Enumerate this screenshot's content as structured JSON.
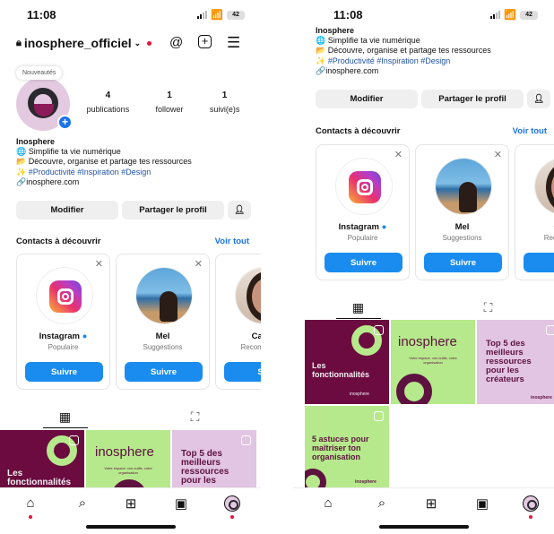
{
  "left": {
    "time": "11:08",
    "battery": "42",
    "username": "inosphere_officiel",
    "note": "Nouveautés",
    "stats": [
      {
        "num": "4",
        "label": "publications"
      },
      {
        "num": "1",
        "label": "follower"
      },
      {
        "num": "1",
        "label": "suivi(e)s"
      }
    ],
    "name": "Inosphere",
    "bio1": "🌐 Simplifie ta vie numérique",
    "bio2": "📂 Découvre, organise et partage tes ressources",
    "bio3": "✨ #Productivité #Inspiration #Design",
    "bio4": "🔗inosphere.com",
    "btn_edit": "Modifier",
    "btn_share": "Partager le profil",
    "sugg_title": "Contacts à découvrir",
    "sugg_all": "Voir tout",
    "cards": [
      {
        "name": "Instagram",
        "sub": "Populaire",
        "follow": "Suivre"
      },
      {
        "name": "Mel",
        "sub": "Suggestions",
        "follow": "Suivre"
      },
      {
        "name": "Cand",
        "sub": "Recom par In",
        "follow": "Su"
      }
    ],
    "tile1": "Les fonctionnalités",
    "tile2": "inosphere",
    "tile2sub": "Votre espace, vos outils, votre organisation",
    "tile3": "Top 5 des meilleurs ressources pour les"
  },
  "right": {
    "time": "11:08",
    "battery": "42",
    "name": "Inosphere",
    "bio1": "🌐 Simplifie ta vie numérique",
    "bio2": "📂 Découvre, organise et partage tes ressources",
    "bio3": "✨ #Productivité #Inspiration #Design",
    "bio4": "🔗inosphere.com",
    "btn_edit": "Modifier",
    "btn_share": "Partager le profil",
    "sugg_title": "Contacts à découvrir",
    "sugg_all": "Voir tout",
    "cards": [
      {
        "name": "Instagram",
        "sub": "Populaire",
        "follow": "Suivre"
      },
      {
        "name": "Mel",
        "sub": "Suggestions",
        "follow": "Suivre"
      },
      {
        "name": "Can",
        "sub": "Reco par Ir",
        "follow": "S"
      }
    ],
    "tile1a": "Les",
    "tile1b": "fonctionnalités",
    "tile1brand": "inosphere",
    "tile2": "inosphere",
    "tile2sub": "Votre espace, vos outils, votre organisation",
    "tile3": "Top 5 des meilleurs ressources pour les créateurs",
    "tile3brand": "inosphere",
    "tile4": "5 astuces pour maîtriser ton organisation",
    "tile4brand": "inosphere"
  },
  "colors": {
    "accent": "#1a8cf0",
    "plum": "#6b0b3f",
    "lime": "#b6e98c",
    "lilac": "#e2c4e3"
  }
}
